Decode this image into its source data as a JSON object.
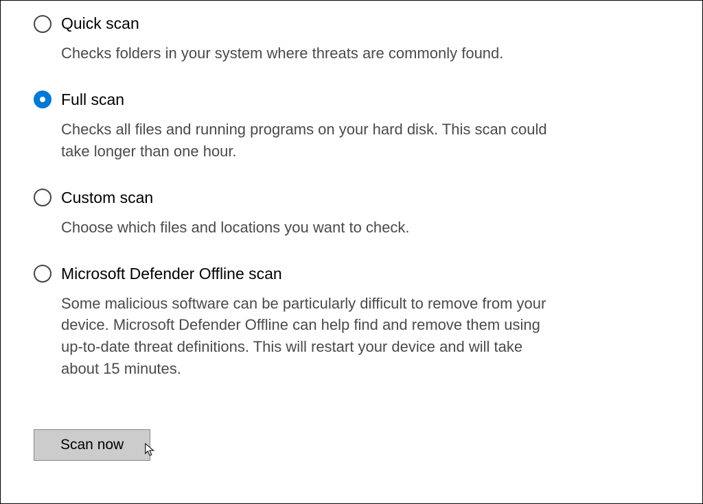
{
  "options": [
    {
      "id": "quick",
      "label": "Quick scan",
      "desc": "Checks folders in your system where threats are commonly found.",
      "selected": false
    },
    {
      "id": "full",
      "label": "Full scan",
      "desc": "Checks all files and running programs on your hard disk. This scan could take longer than one hour.",
      "selected": true
    },
    {
      "id": "custom",
      "label": "Custom scan",
      "desc": "Choose which files and locations you want to check.",
      "selected": false
    },
    {
      "id": "offline",
      "label": "Microsoft Defender Offline scan",
      "desc": "Some malicious software can be particularly difficult to remove from your device. Microsoft Defender Offline can help find and remove them using up-to-date threat definitions. This will restart your device and will take about 15 minutes.",
      "selected": false
    }
  ],
  "button": {
    "label": "Scan now"
  }
}
